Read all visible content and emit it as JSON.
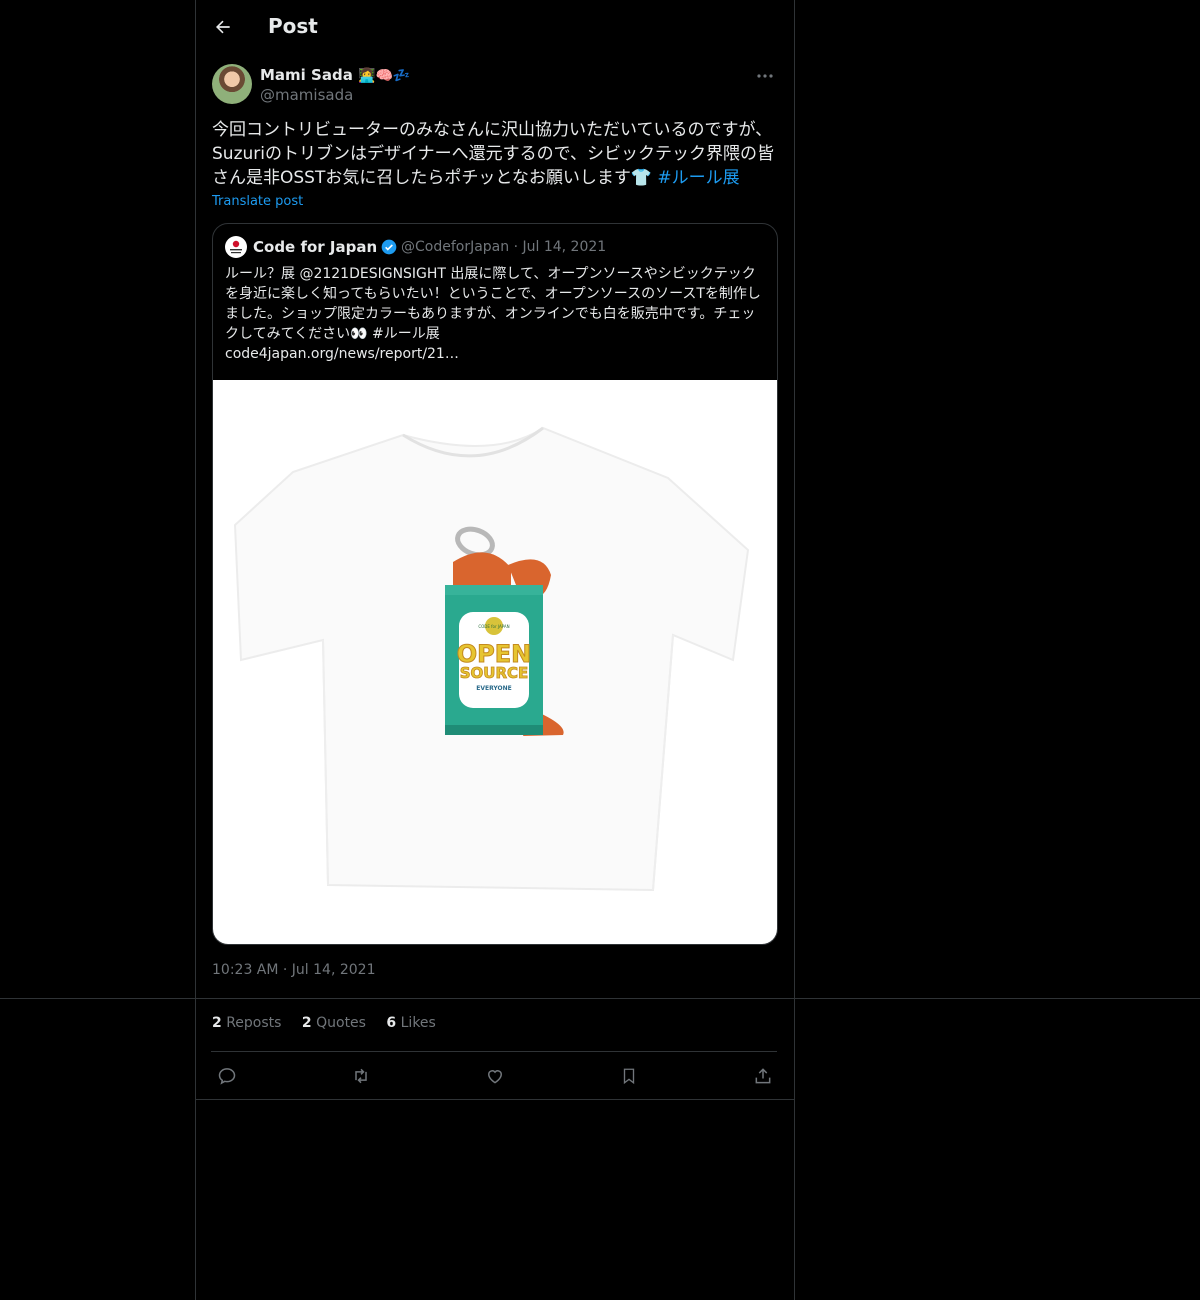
{
  "header": {
    "title": "Post"
  },
  "post": {
    "author_name": "Mami Sada",
    "author_emoji": "👩‍💻🧠💤",
    "handle": "@mamisada",
    "text": "今回コントリビューターのみなさんに沢山協力いただいているのですが、Suzuriのトリブンはデザイナーへ還元するので、シビックテック界隈の皆さん是非OSSTお気に召したらポチッとなお願いします👕",
    "hashtag": "#ルール展",
    "translate": "Translate post",
    "timestamp": "10:23 AM · Jul 14, 2021"
  },
  "quote": {
    "name": "Code for Japan",
    "meta": "@CodeforJapan · Jul 14, 2021",
    "text": "ルール？展 @2121DESIGNSIGHT 出展に際して、オープンソースやシビックテックを身近に楽しく知ってもらいたい！ということで、オープンソースのソースTを制作しました。ショップ限定カラーもありますが、オンラインでも白を販売中です。チェックしてみてください👀 #ルール展\ncode4japan.org/news/report/21…",
    "image": {
      "brand": "CODE for JAPAN",
      "line1": "OPEN",
      "line2": "SOURCE",
      "line3": "EVERYONE"
    }
  },
  "stats": {
    "reposts_count": "2",
    "reposts_label": "Reposts",
    "quotes_count": "2",
    "quotes_label": "Quotes",
    "likes_count": "6",
    "likes_label": "Likes"
  },
  "colors": {
    "accent": "#1d9bf0",
    "muted": "#71767b",
    "border": "#2f3336"
  }
}
